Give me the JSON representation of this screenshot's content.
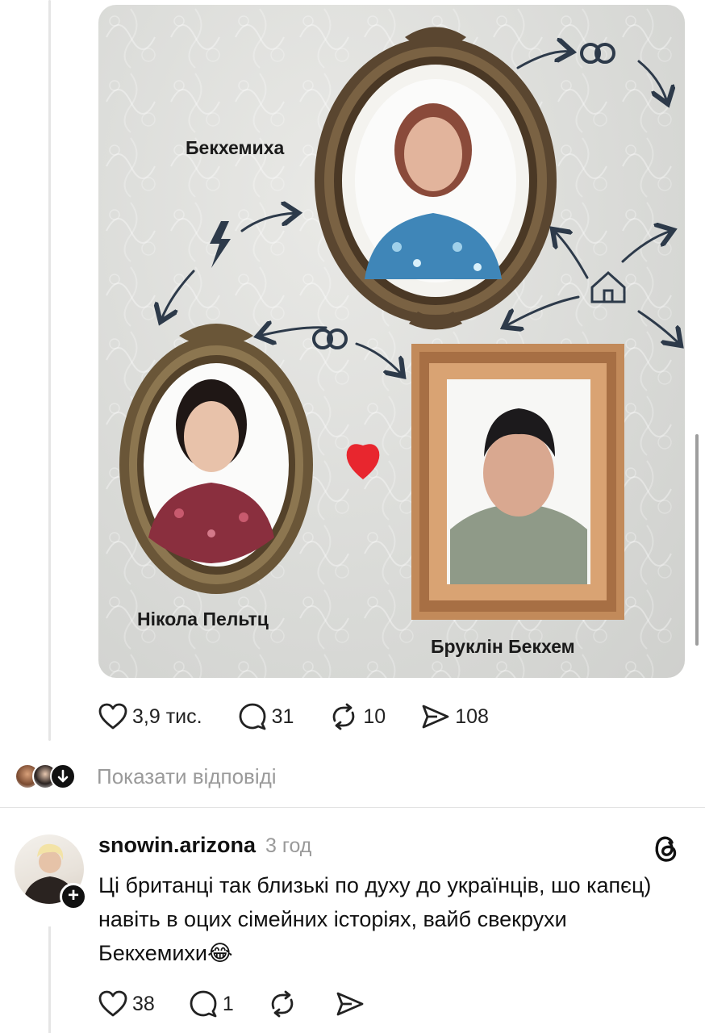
{
  "post": {
    "image": {
      "labels": {
        "top": "Бекхемиха",
        "left": "Нікола Пельтц",
        "right": "Бруклін Бекхем"
      },
      "icons": [
        "rings-icon",
        "lightning-icon",
        "house-icon",
        "heart-icon",
        "arrow-icon"
      ]
    },
    "actions": {
      "likes": "3,9 тис.",
      "comments": "31",
      "reposts": "10",
      "shares": "108"
    },
    "show_replies": "Показати відповіді"
  },
  "comment": {
    "username": "snowin.arizona",
    "time": "3 год",
    "text": "Ці британці так близькі по духу до українців, шо капєц) навіть в оцих сімейних історіях, вайб свекрухи Бекхемихи😂",
    "actions": {
      "likes": "38",
      "comments": "1"
    }
  },
  "colors": {
    "heart": "#e8262e",
    "muted": "#9a9a9a",
    "ink": "#2d3a4a"
  }
}
